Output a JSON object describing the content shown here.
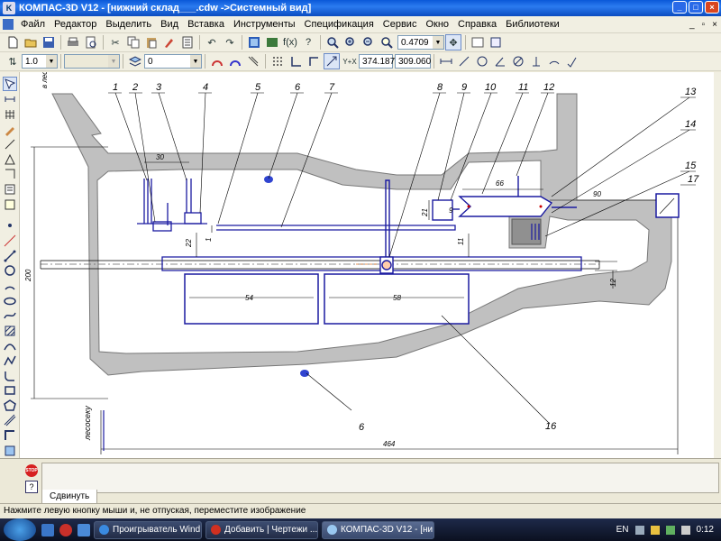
{
  "window": {
    "title": "КОМПАС-3D V12 - [нижний склад___.cdw ->Системный вид]"
  },
  "menu": [
    "Файл",
    "Редактор",
    "Выделить",
    "Вид",
    "Вставка",
    "Инструменты",
    "Спецификация",
    "Сервис",
    "Окно",
    "Справка",
    "Библиотеки"
  ],
  "toolbar": {
    "zoom_value": "0.4709",
    "step_value": "1.0",
    "layer_value": "0",
    "coord_x": "374.187",
    "coord_y": "309.060"
  },
  "drawing": {
    "leader_numbers": [
      "1",
      "2",
      "3",
      "4",
      "5",
      "6",
      "7",
      "8",
      "9",
      "10",
      "11",
      "12",
      "13",
      "14",
      "15",
      "16",
      "17"
    ],
    "lower_label_6": "6",
    "lower_label_16": "16",
    "dim_30": "30",
    "dim_66": "66",
    "dim_90": "90",
    "dim_21": "21",
    "dim_9": "9",
    "dim_11": "11",
    "dim_22": "22",
    "dim_1": "1",
    "dim_12": "12",
    "dim_200": "200",
    "dim_54": "54",
    "dim_58": "58",
    "dim_464": "464",
    "side_label": "лесосеку",
    "top_left_label": "в лес"
  },
  "properties": {
    "stop_label": "STOP",
    "tab_label": "Сдвинуть"
  },
  "status": {
    "hint": "Нажмите левую кнопку мыши и, не отпуская, переместите изображение"
  },
  "taskbar": {
    "buttons": [
      "Проигрыватель Wind...",
      "Добавить | Чертежи ...",
      "КОМПАС-3D V12 - [ни..."
    ],
    "lang": "EN",
    "clock": "0:12"
  }
}
